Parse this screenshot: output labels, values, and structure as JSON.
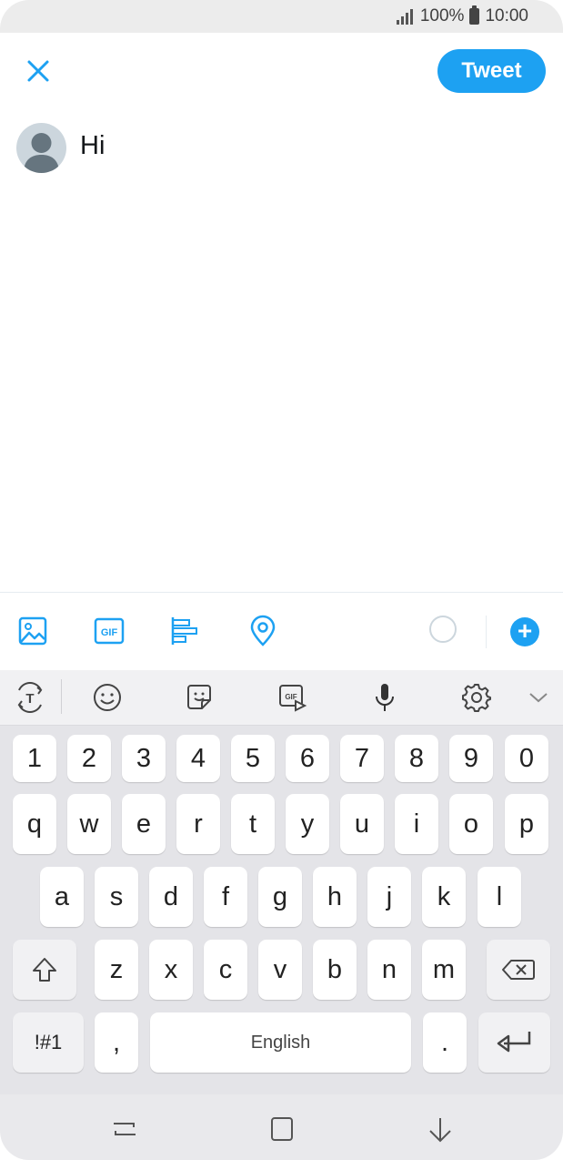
{
  "status_bar": {
    "battery": "100%",
    "time": "10:00"
  },
  "compose": {
    "tweet_button": "Tweet",
    "tweet_text": "Hi"
  },
  "compose_toolbar": {
    "icons": [
      "image-icon",
      "gif-icon",
      "poll-icon",
      "location-icon"
    ]
  },
  "keyboard_toolbar": {
    "icons": [
      "text-tool-icon",
      "emoji-icon",
      "sticker-icon",
      "gif-icon",
      "microphone-icon",
      "settings-icon",
      "collapse-icon"
    ]
  },
  "keyboard": {
    "row_numbers": [
      "1",
      "2",
      "3",
      "4",
      "5",
      "6",
      "7",
      "8",
      "9",
      "0"
    ],
    "row1": [
      "q",
      "w",
      "e",
      "r",
      "t",
      "y",
      "u",
      "i",
      "o",
      "p"
    ],
    "row2": [
      "a",
      "s",
      "d",
      "f",
      "g",
      "h",
      "j",
      "k",
      "l"
    ],
    "row3": [
      "z",
      "x",
      "c",
      "v",
      "b",
      "n",
      "m"
    ],
    "symbols": "!#1",
    "comma": ",",
    "space": "English",
    "period": "."
  },
  "colors": {
    "accent": "#1da1f2"
  }
}
